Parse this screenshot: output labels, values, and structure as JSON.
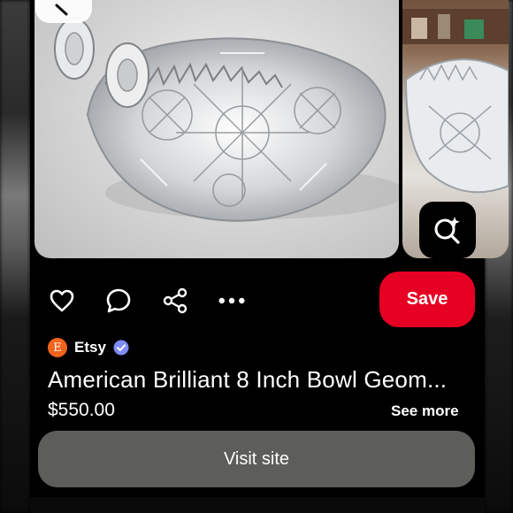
{
  "pin": {
    "image_alt": "Cut crystal bowl with handle",
    "save_label": "Save",
    "source": {
      "logo_letter": "E",
      "name": "Etsy",
      "logo_color": "#f1641e",
      "verified_color": "#7f8cf5"
    },
    "title": "American Brilliant 8 Inch Bowl Geom...",
    "price": "$550.00",
    "see_more_label": "See more",
    "visit_label": "Visit site"
  },
  "actions": {
    "icons": [
      "heart-icon",
      "comment-icon",
      "share-icon",
      "more-icon"
    ]
  },
  "colors": {
    "save_button": "#e60023",
    "visit_button": "#5d5d59",
    "background": "#000000"
  }
}
